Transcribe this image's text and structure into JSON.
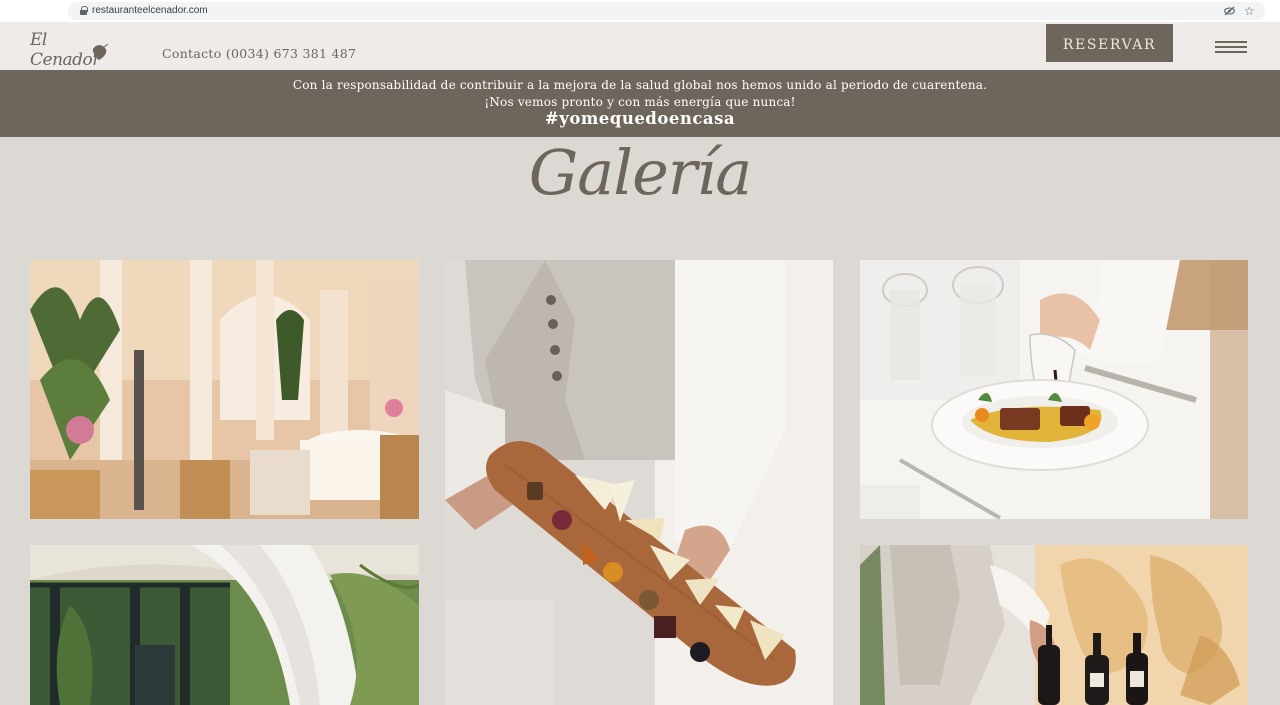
{
  "browser": {
    "url": "restauranteelcenador.com"
  },
  "header": {
    "logo_text": "El Cenador",
    "contact": "Contacto (0034) 673 381 487",
    "reserve_label": "RESERVAR"
  },
  "banner": {
    "line1": "Con la responsabilidad de contribuir a la mejora de la salud global nos hemos unido al periodo de cuarentena.",
    "line2": "¡Nos vemos pronto y con más energía que nunca!",
    "hashtag": "#yomequedoencasa"
  },
  "gallery": {
    "title": "Galería"
  },
  "colors": {
    "brand": "#6e655c",
    "header_bg": "#efebe8",
    "page_bg": "#dcd8d4"
  }
}
